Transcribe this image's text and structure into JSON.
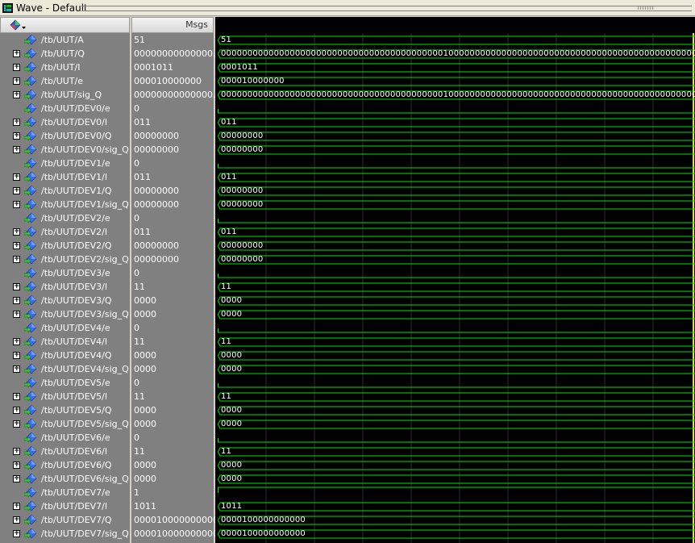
{
  "window": {
    "title": "Wave - Default"
  },
  "header": {
    "msgs_label": "Msgs",
    "cursor_icon": "wave-cursor-icon"
  },
  "colors": {
    "wave_green": "#00e000",
    "grid": "#2e2e2e",
    "pane_gray": "#808080",
    "cursor_yellow": "#f0e000"
  },
  "signals": [
    {
      "name": "/tb/UUT/A",
      "value": "51",
      "wave": "51",
      "kind": "bus",
      "expandable": false
    },
    {
      "name": "/tb/UUT/Q",
      "value": "00000000000000...",
      "wave": "00000000000000000000000000000000000000000010000000000000000000000000000000000000000000000000",
      "kind": "bus",
      "expandable": true
    },
    {
      "name": "/tb/UUT/I",
      "value": "0001011",
      "wave": "0001011",
      "kind": "bus",
      "expandable": true
    },
    {
      "name": "/tb/UUT/e",
      "value": "000010000000",
      "wave": "000010000000",
      "kind": "bus",
      "expandable": true
    },
    {
      "name": "/tb/UUT/sig_Q",
      "value": "00000000000000...",
      "wave": "00000000000000000000000000000000000000000010000000000000000000000000000000000000000000000000",
      "kind": "bus",
      "expandable": true
    },
    {
      "name": "/tb/UUT/DEV0/e",
      "value": "0",
      "wave": "",
      "kind": "bit",
      "level": 0,
      "expandable": false
    },
    {
      "name": "/tb/UUT/DEV0/I",
      "value": "011",
      "wave": "011",
      "kind": "bus",
      "expandable": true
    },
    {
      "name": "/tb/UUT/DEV0/Q",
      "value": "00000000",
      "wave": "00000000",
      "kind": "bus",
      "expandable": true
    },
    {
      "name": "/tb/UUT/DEV0/sig_Q",
      "value": "00000000",
      "wave": "00000000",
      "kind": "bus",
      "expandable": true
    },
    {
      "name": "/tb/UUT/DEV1/e",
      "value": "0",
      "wave": "",
      "kind": "bit",
      "level": 0,
      "expandable": false
    },
    {
      "name": "/tb/UUT/DEV1/I",
      "value": "011",
      "wave": "011",
      "kind": "bus",
      "expandable": true
    },
    {
      "name": "/tb/UUT/DEV1/Q",
      "value": "00000000",
      "wave": "00000000",
      "kind": "bus",
      "expandable": true
    },
    {
      "name": "/tb/UUT/DEV1/sig_Q",
      "value": "00000000",
      "wave": "00000000",
      "kind": "bus",
      "expandable": true
    },
    {
      "name": "/tb/UUT/DEV2/e",
      "value": "0",
      "wave": "",
      "kind": "bit",
      "level": 0,
      "expandable": false
    },
    {
      "name": "/tb/UUT/DEV2/I",
      "value": "011",
      "wave": "011",
      "kind": "bus",
      "expandable": true
    },
    {
      "name": "/tb/UUT/DEV2/Q",
      "value": "00000000",
      "wave": "00000000",
      "kind": "bus",
      "expandable": true
    },
    {
      "name": "/tb/UUT/DEV2/sig_Q",
      "value": "00000000",
      "wave": "00000000",
      "kind": "bus",
      "expandable": true
    },
    {
      "name": "/tb/UUT/DEV3/e",
      "value": "0",
      "wave": "",
      "kind": "bit",
      "level": 0,
      "expandable": false
    },
    {
      "name": "/tb/UUT/DEV3/I",
      "value": "11",
      "wave": "11",
      "kind": "bus",
      "expandable": true
    },
    {
      "name": "/tb/UUT/DEV3/Q",
      "value": "0000",
      "wave": "0000",
      "kind": "bus",
      "expandable": true
    },
    {
      "name": "/tb/UUT/DEV3/sig_Q",
      "value": "0000",
      "wave": "0000",
      "kind": "bus",
      "expandable": true
    },
    {
      "name": "/tb/UUT/DEV4/e",
      "value": "0",
      "wave": "",
      "kind": "bit",
      "level": 0,
      "expandable": false
    },
    {
      "name": "/tb/UUT/DEV4/I",
      "value": "11",
      "wave": "11",
      "kind": "bus",
      "expandable": true
    },
    {
      "name": "/tb/UUT/DEV4/Q",
      "value": "0000",
      "wave": "0000",
      "kind": "bus",
      "expandable": true
    },
    {
      "name": "/tb/UUT/DEV4/sig_Q",
      "value": "0000",
      "wave": "0000",
      "kind": "bus",
      "expandable": true
    },
    {
      "name": "/tb/UUT/DEV5/e",
      "value": "0",
      "wave": "",
      "kind": "bit",
      "level": 0,
      "expandable": false
    },
    {
      "name": "/tb/UUT/DEV5/I",
      "value": "11",
      "wave": "11",
      "kind": "bus",
      "expandable": true
    },
    {
      "name": "/tb/UUT/DEV5/Q",
      "value": "0000",
      "wave": "0000",
      "kind": "bus",
      "expandable": true
    },
    {
      "name": "/tb/UUT/DEV5/sig_Q",
      "value": "0000",
      "wave": "0000",
      "kind": "bus",
      "expandable": true
    },
    {
      "name": "/tb/UUT/DEV6/e",
      "value": "0",
      "wave": "",
      "kind": "bit",
      "level": 0,
      "expandable": false
    },
    {
      "name": "/tb/UUT/DEV6/I",
      "value": "11",
      "wave": "11",
      "kind": "bus",
      "expandable": true
    },
    {
      "name": "/tb/UUT/DEV6/Q",
      "value": "0000",
      "wave": "0000",
      "kind": "bus",
      "expandable": true
    },
    {
      "name": "/tb/UUT/DEV6/sig_Q",
      "value": "0000",
      "wave": "0000",
      "kind": "bus",
      "expandable": true
    },
    {
      "name": "/tb/UUT/DEV7/e",
      "value": "1",
      "wave": "",
      "kind": "bit",
      "level": 1,
      "expandable": false
    },
    {
      "name": "/tb/UUT/DEV7/I",
      "value": "1011",
      "wave": "1011",
      "kind": "bus",
      "expandable": true
    },
    {
      "name": "/tb/UUT/DEV7/Q",
      "value": "0000100000000000",
      "wave": "0000100000000000",
      "kind": "bus",
      "expandable": true
    },
    {
      "name": "/tb/UUT/DEV7/sig_Q",
      "value": "0000100000000000",
      "wave": "0000100000000000",
      "kind": "bus",
      "expandable": true
    }
  ]
}
